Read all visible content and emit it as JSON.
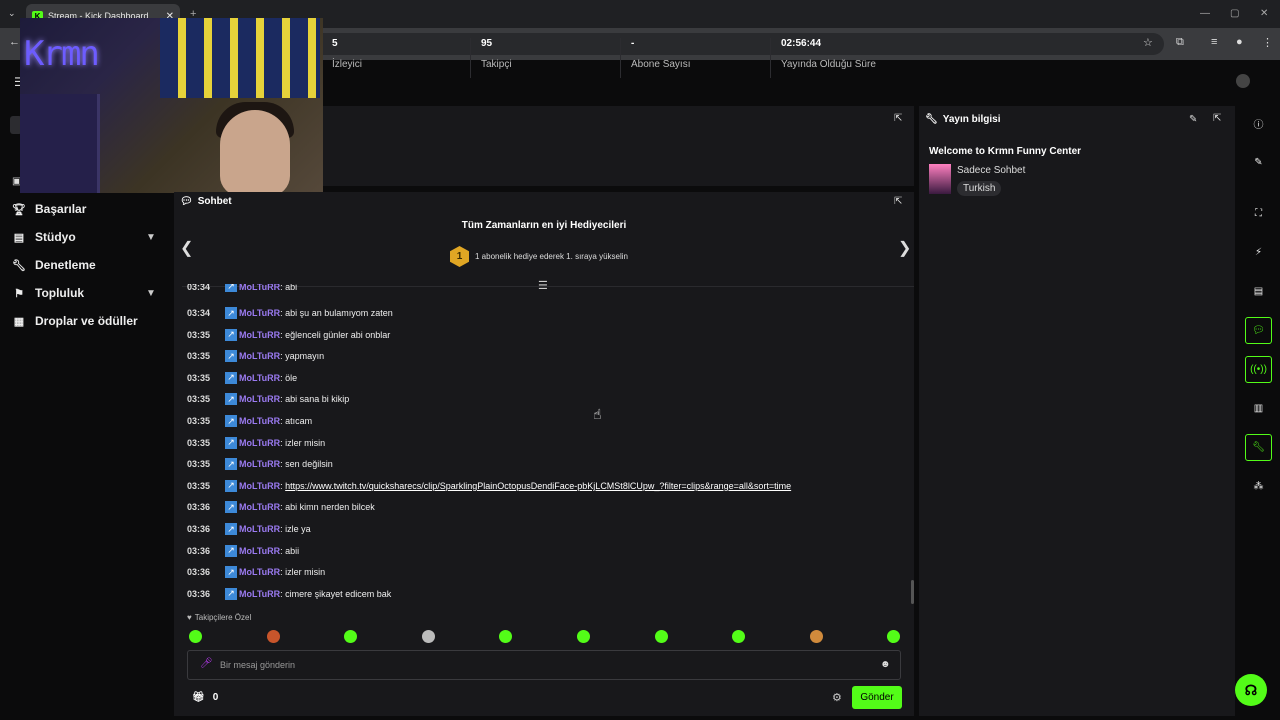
{
  "browser": {
    "tab_title": "Stream - Kick Dashboard",
    "tab_close": "✕",
    "new_tab": "+"
  },
  "sidebar": {
    "items": [
      {
        "label": "Başarılar",
        "icon": "trophy-icon"
      },
      {
        "label": "Stüdyo",
        "icon": "studio-icon"
      },
      {
        "label": "Denetleme",
        "icon": "wrench-icon"
      },
      {
        "label": "Topluluk",
        "icon": "community-icon"
      },
      {
        "label": "Droplar ve ödüller",
        "icon": "drops-icon"
      }
    ]
  },
  "webcam": {
    "overlay_text": "Krmn"
  },
  "stats": [
    {
      "value": "5",
      "label": "İzleyici"
    },
    {
      "value": "95",
      "label": "Takipçi"
    },
    {
      "value": "-",
      "label": "Abone Sayısı"
    },
    {
      "value": "02:56:44",
      "label": "Yayında Olduğu Süre"
    }
  ],
  "chat": {
    "title": "Sohbet",
    "gifters_title": "Tüm Zamanların en iyi Hediyecileri",
    "gifters_rank": "1",
    "gifters_sub": "1 abonelik hediye ederek 1. sıraya yükselin",
    "partial_message": {
      "time": "03:34",
      "user": "MoLTuRR",
      "text": "abi"
    },
    "messages": [
      {
        "time": "03:34",
        "user": "MoLTuRR",
        "text": "abi şu an bulamıyom zaten"
      },
      {
        "time": "03:35",
        "user": "MoLTuRR",
        "text": "eğlenceli günler abi onblar"
      },
      {
        "time": "03:35",
        "user": "MoLTuRR",
        "text": "yapmayın"
      },
      {
        "time": "03:35",
        "user": "MoLTuRR",
        "text": "öle"
      },
      {
        "time": "03:35",
        "user": "MoLTuRR",
        "text": "abi sana bi kikip"
      },
      {
        "time": "03:35",
        "user": "MoLTuRR",
        "text": "atıcam"
      },
      {
        "time": "03:35",
        "user": "MoLTuRR",
        "text": "izler misin"
      },
      {
        "time": "03:35",
        "user": "MoLTuRR",
        "text": "sen değilsin"
      },
      {
        "time": "03:35",
        "user": "MoLTuRR",
        "text": "https://www.twitch.tv/quicksharecs/clip/SparklingPlainOctopusDendiFace-pbKjLCMSt8lCUpw_?filter=clips&range=all&sort=time",
        "link": true
      },
      {
        "time": "03:36",
        "user": "MoLTuRR",
        "text": "abi kimn nerden bilcek"
      },
      {
        "time": "03:36",
        "user": "MoLTuRR",
        "text": "izle ya"
      },
      {
        "time": "03:36",
        "user": "MoLTuRR",
        "text": "abii"
      },
      {
        "time": "03:36",
        "user": "MoLTuRR",
        "text": "izler misin"
      },
      {
        "time": "03:36",
        "user": "MoLTuRR",
        "text": "cimere şikayet edicem bak"
      }
    ],
    "followers_only": "Takipçilere Özel",
    "input_placeholder": "Bir mesaj gönderin",
    "gift_count": "0",
    "send_label": "Gönder"
  },
  "stream_info": {
    "title": "Yayın bilgisi",
    "stream_title": "Welcome to Krmn Funny Center",
    "category": "Sadece Sohbet",
    "language": "Turkish"
  },
  "colors": {
    "accent": "#53fc18",
    "username": "#9a7af0",
    "panel": "#18181b",
    "background": "#0b0b0c"
  }
}
